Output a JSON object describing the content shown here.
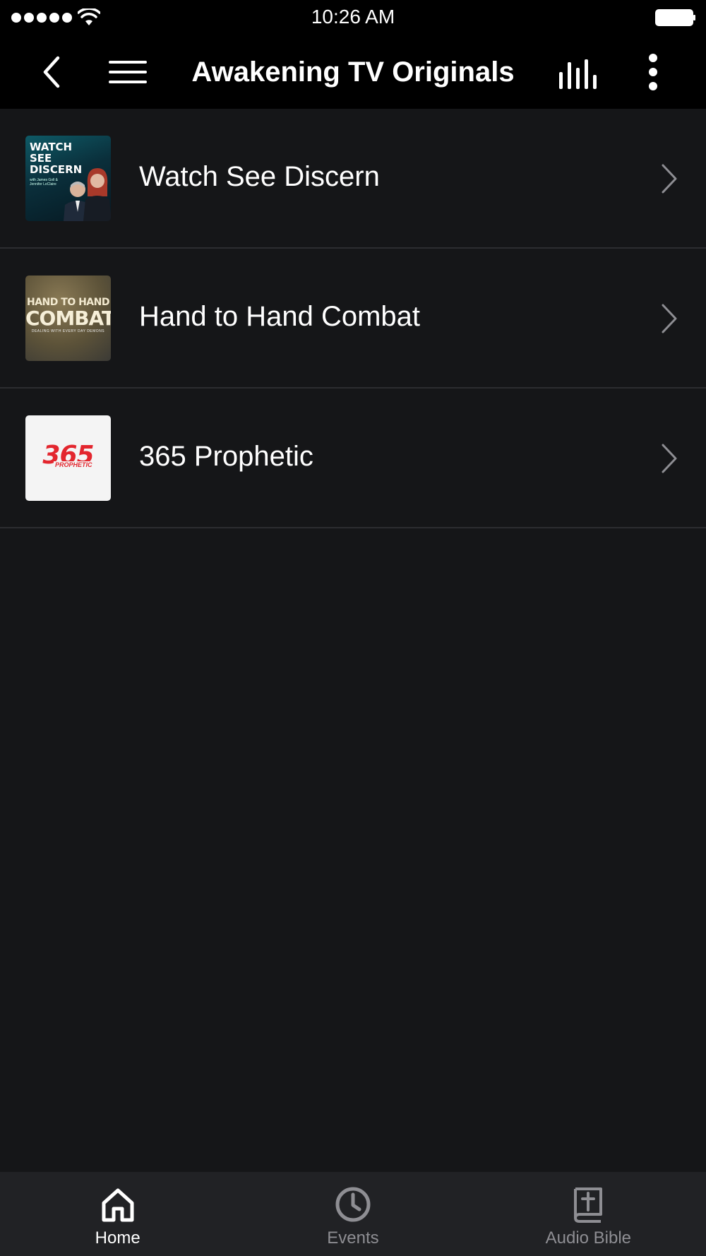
{
  "status_bar": {
    "time": "10:26 AM"
  },
  "nav": {
    "title": "Awakening TV Originals",
    "back_icon": "chevron-left-icon",
    "menu_icon": "hamburger-icon",
    "equalizer_icon": "equalizer-icon",
    "more_icon": "more-vertical-icon"
  },
  "list": {
    "items": [
      {
        "label": "Watch See Discern",
        "thumb": {
          "title_lines": "WATCH\nSEE\nDISCERN",
          "subtitle": "with James Goll & Jennifer LeClaire"
        }
      },
      {
        "label": "Hand to Hand Combat",
        "thumb": {
          "line1": "HAND TO HAND",
          "line2": "COMBAT",
          "line3": "DEALING WITH EVERY DAY DEMONS"
        }
      },
      {
        "label": "365 Prophetic",
        "thumb": {
          "big": "365",
          "small": "PROPHETIC"
        }
      }
    ]
  },
  "tab_bar": {
    "tabs": [
      {
        "label": "Home",
        "icon": "home-icon",
        "active": true
      },
      {
        "label": "Events",
        "icon": "clock-icon",
        "active": false
      },
      {
        "label": "Audio Bible",
        "icon": "bible-icon",
        "active": false
      }
    ]
  },
  "colors": {
    "background": "#151618",
    "nav_background": "#000000",
    "tab_bar_background": "#212225",
    "divider": "#2c2d30",
    "inactive_tab": "#8e8e93",
    "accent_red": "#e3262e"
  }
}
